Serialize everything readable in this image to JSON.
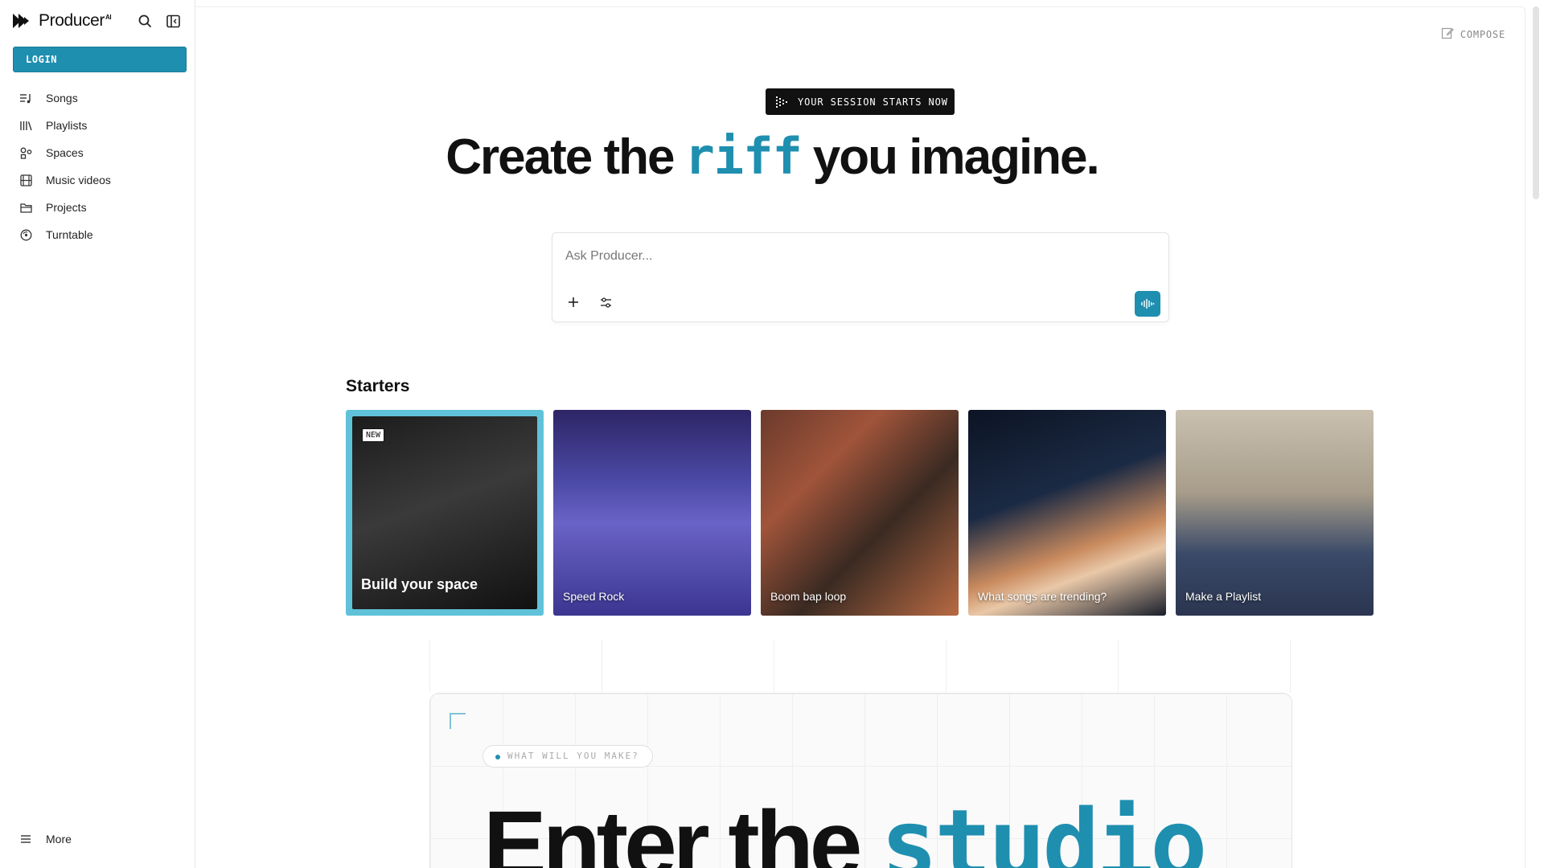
{
  "app": {
    "brand": "Producer",
    "brand_superscript": "AI",
    "accent_color": "#1f8fb0"
  },
  "sidebar": {
    "login_label": "LOGIN",
    "items": [
      {
        "label": "Songs",
        "icon": "songs-icon"
      },
      {
        "label": "Playlists",
        "icon": "playlists-icon"
      },
      {
        "label": "Spaces",
        "icon": "spaces-icon"
      },
      {
        "label": "Music videos",
        "icon": "film-icon"
      },
      {
        "label": "Projects",
        "icon": "folder-icon"
      },
      {
        "label": "Turntable",
        "icon": "turntable-icon"
      }
    ],
    "more_label": "More"
  },
  "header": {
    "compose_label": "COMPOSE"
  },
  "hero": {
    "badge": "YOUR SESSION STARTS NOW",
    "title_before": "Create the",
    "title_accent": "riff",
    "title_after": "you imagine."
  },
  "ask": {
    "placeholder": "Ask Producer..."
  },
  "starters": {
    "title": "Starters",
    "cards": [
      {
        "label": "Build your space",
        "badge": "NEW"
      },
      {
        "label": "Speed Rock"
      },
      {
        "label": "Boom bap loop"
      },
      {
        "label": "What songs are trending?"
      },
      {
        "label": "Make a Playlist"
      }
    ]
  },
  "studio": {
    "pill": "WHAT WILL YOU MAKE?",
    "title_before": "Enter the",
    "title_accent": "studio"
  }
}
